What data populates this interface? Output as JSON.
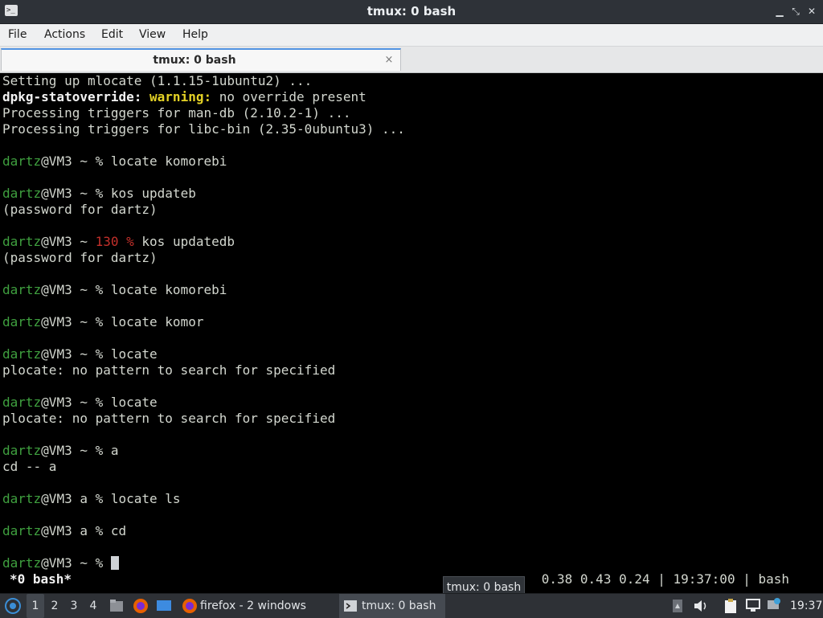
{
  "window": {
    "title": "tmux: 0 bash"
  },
  "menu": [
    "File",
    "Actions",
    "Edit",
    "View",
    "Help"
  ],
  "tab": {
    "label": "tmux: 0 bash",
    "close": "×"
  },
  "terminal": {
    "lines": [
      [
        {
          "t": "Setting up mlocate (1.1.15-1ubuntu2) ..."
        }
      ],
      [
        {
          "t": "dpkg-statoverride:",
          "c": "bold"
        },
        {
          "t": " "
        },
        {
          "t": "warning:",
          "c": "warn"
        },
        {
          "t": " no override present"
        }
      ],
      [
        {
          "t": "Processing triggers for man-db (2.10.2-1) ..."
        }
      ],
      [
        {
          "t": "Processing triggers for libc-bin (2.35-0ubuntu3) ..."
        }
      ],
      [],
      [
        {
          "t": "dartz",
          "c": "user"
        },
        {
          "t": "@VM3 ~ % locate komorebi"
        }
      ],
      [],
      [
        {
          "t": "dartz",
          "c": "user"
        },
        {
          "t": "@VM3 ~ % kos updateb"
        }
      ],
      [
        {
          "t": "(password for dartz)"
        }
      ],
      [],
      [
        {
          "t": "dartz",
          "c": "user"
        },
        {
          "t": "@VM3 ~ "
        },
        {
          "t": "130 %",
          "c": "red"
        },
        {
          "t": " kos updatedb"
        }
      ],
      [
        {
          "t": "(password for dartz)"
        }
      ],
      [],
      [
        {
          "t": "dartz",
          "c": "user"
        },
        {
          "t": "@VM3 ~ % locate komorebi"
        }
      ],
      [],
      [
        {
          "t": "dartz",
          "c": "user"
        },
        {
          "t": "@VM3 ~ % locate komor"
        }
      ],
      [],
      [
        {
          "t": "dartz",
          "c": "user"
        },
        {
          "t": "@VM3 ~ % locate"
        }
      ],
      [
        {
          "t": "plocate: no pattern to search for specified"
        }
      ],
      [],
      [
        {
          "t": "dartz",
          "c": "user"
        },
        {
          "t": "@VM3 ~ % locate"
        }
      ],
      [
        {
          "t": "plocate: no pattern to search for specified"
        }
      ],
      [],
      [
        {
          "t": "dartz",
          "c": "user"
        },
        {
          "t": "@VM3 ~ % a"
        }
      ],
      [
        {
          "t": "cd -- a"
        }
      ],
      [],
      [
        {
          "t": "dartz",
          "c": "user"
        },
        {
          "t": "@VM3 a % locate ls"
        }
      ],
      [],
      [
        {
          "t": "dartz",
          "c": "user"
        },
        {
          "t": "@VM3 a % cd"
        }
      ],
      [],
      [
        {
          "t": "dartz",
          "c": "user"
        },
        {
          "t": "@VM3 ~ % "
        },
        {
          "cursor": true
        }
      ]
    ]
  },
  "tmux_status": {
    "window": "*0 bash*",
    "right": "0.38 0.43 0.24 | 19:37:00 | bash"
  },
  "tooltip": "tmux: 0 bash",
  "taskbar": {
    "workspaces": [
      "1",
      "2",
      "3",
      "4"
    ],
    "active_workspace": "1",
    "tasks": [
      {
        "label": "firefox - 2 windows",
        "icon": "firefox-icon"
      },
      {
        "label": "tmux: 0 bash",
        "icon": "terminal-icon",
        "active": true
      }
    ],
    "clock": "19:37",
    "colors": {
      "accent": "#5294e2",
      "prompt_user": "#3fa03f",
      "error": "#c4302b",
      "warning": "#e4d226"
    }
  }
}
